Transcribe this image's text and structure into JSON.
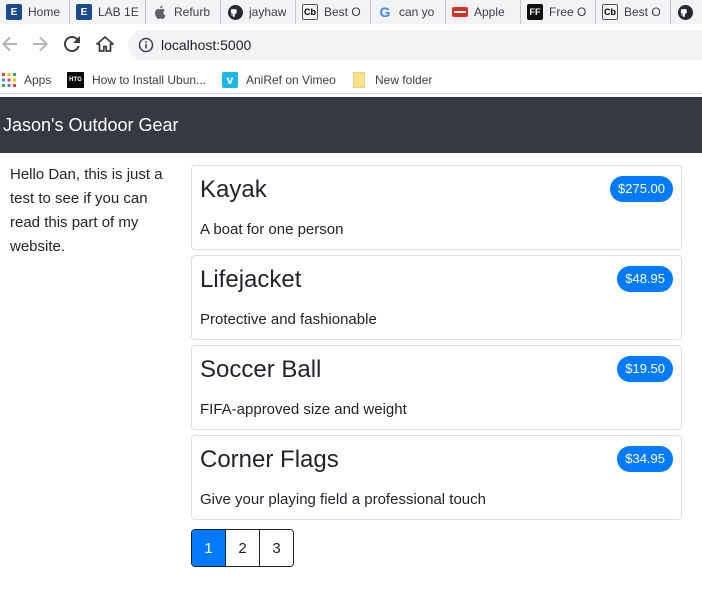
{
  "browser": {
    "tabs": [
      {
        "label": "Home",
        "icon": "e-square-icon",
        "icon_text": "E"
      },
      {
        "label": "LAB 1E",
        "icon": "e-square-icon",
        "icon_text": "E"
      },
      {
        "label": "Refurb",
        "icon": "apple-icon",
        "icon_text": ""
      },
      {
        "label": "jayhaw",
        "icon": "github-icon",
        "icon_text": ""
      },
      {
        "label": "Best O",
        "icon": "cb-icon",
        "icon_text": "Cb"
      },
      {
        "label": "can yo",
        "icon": "google-icon",
        "icon_text": "G"
      },
      {
        "label": "Apple",
        "icon": "apple-site-icon",
        "icon_text": ""
      },
      {
        "label": "Free O",
        "icon": "ff-icon",
        "icon_text": "FF"
      },
      {
        "label": "Best O",
        "icon": "cb-icon",
        "icon_text": "Cb"
      },
      {
        "label": "",
        "icon": "github-icon",
        "icon_text": ""
      }
    ],
    "url": "localhost:5000",
    "bookmarks": [
      {
        "label": "Apps",
        "icon": "apps-grid-icon"
      },
      {
        "label": "How to Install Ubun...",
        "icon": "htg-icon",
        "icon_text": "HTG"
      },
      {
        "label": "AniRef on Vimeo",
        "icon": "vimeo-icon",
        "icon_text": "v"
      },
      {
        "label": "New folder",
        "icon": "folder-icon"
      }
    ]
  },
  "site": {
    "brand": "Jason's Outdoor Gear",
    "sidebar_text": "Hello Dan, this is just a test to see if you can read this part of my website."
  },
  "products": [
    {
      "name": "Kayak",
      "price": "$275.00",
      "description": "A boat for one person"
    },
    {
      "name": "Lifejacket",
      "price": "$48.95",
      "description": "Protective and fashionable"
    },
    {
      "name": "Soccer Ball",
      "price": "$19.50",
      "description": "FIFA-approved size and weight"
    },
    {
      "name": "Corner Flags",
      "price": "$34.95",
      "description": "Give your playing field a professional touch"
    }
  ],
  "pagination": {
    "pages": [
      "1",
      "2",
      "3"
    ],
    "active": "1"
  },
  "colors": {
    "navbar": "#343a40",
    "primary": "#007bff"
  }
}
